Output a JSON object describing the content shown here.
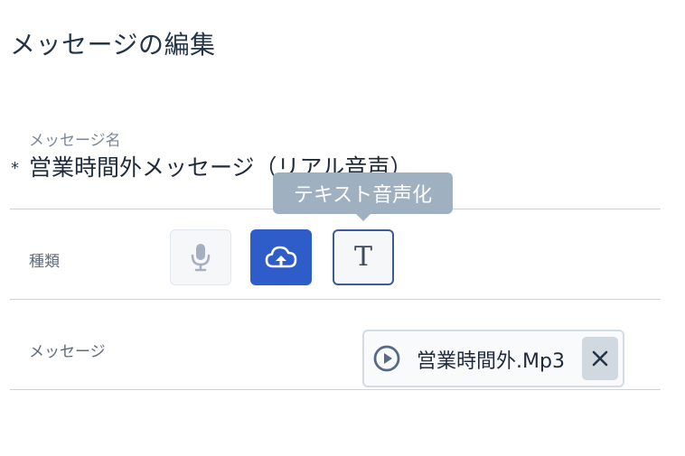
{
  "header": {
    "title": "メッセージの編集"
  },
  "form": {
    "message_name": {
      "label": "メッセージ名",
      "required_mark": "*",
      "value": "営業時間外メッセージ（リアル音声）"
    },
    "type": {
      "label": "種類",
      "options": [
        {
          "icon": "microphone-icon",
          "state": "disabled"
        },
        {
          "icon": "cloud-upload-icon",
          "state": "selected"
        },
        {
          "icon": "text-icon",
          "glyph": "T",
          "state": "focused"
        }
      ],
      "tooltip": "テキスト音声化"
    },
    "message": {
      "label": "メッセージ",
      "file": {
        "name": "営業時間外.Mp3",
        "play_icon": "play-icon",
        "remove_icon": "close-icon"
      }
    }
  },
  "colors": {
    "accent": "#2e5cc8",
    "tooltip_bg": "#9fb0c1",
    "divider": "#c9d3dd",
    "text_primary": "#1f2b3a",
    "label_muted": "#7b8796"
  }
}
